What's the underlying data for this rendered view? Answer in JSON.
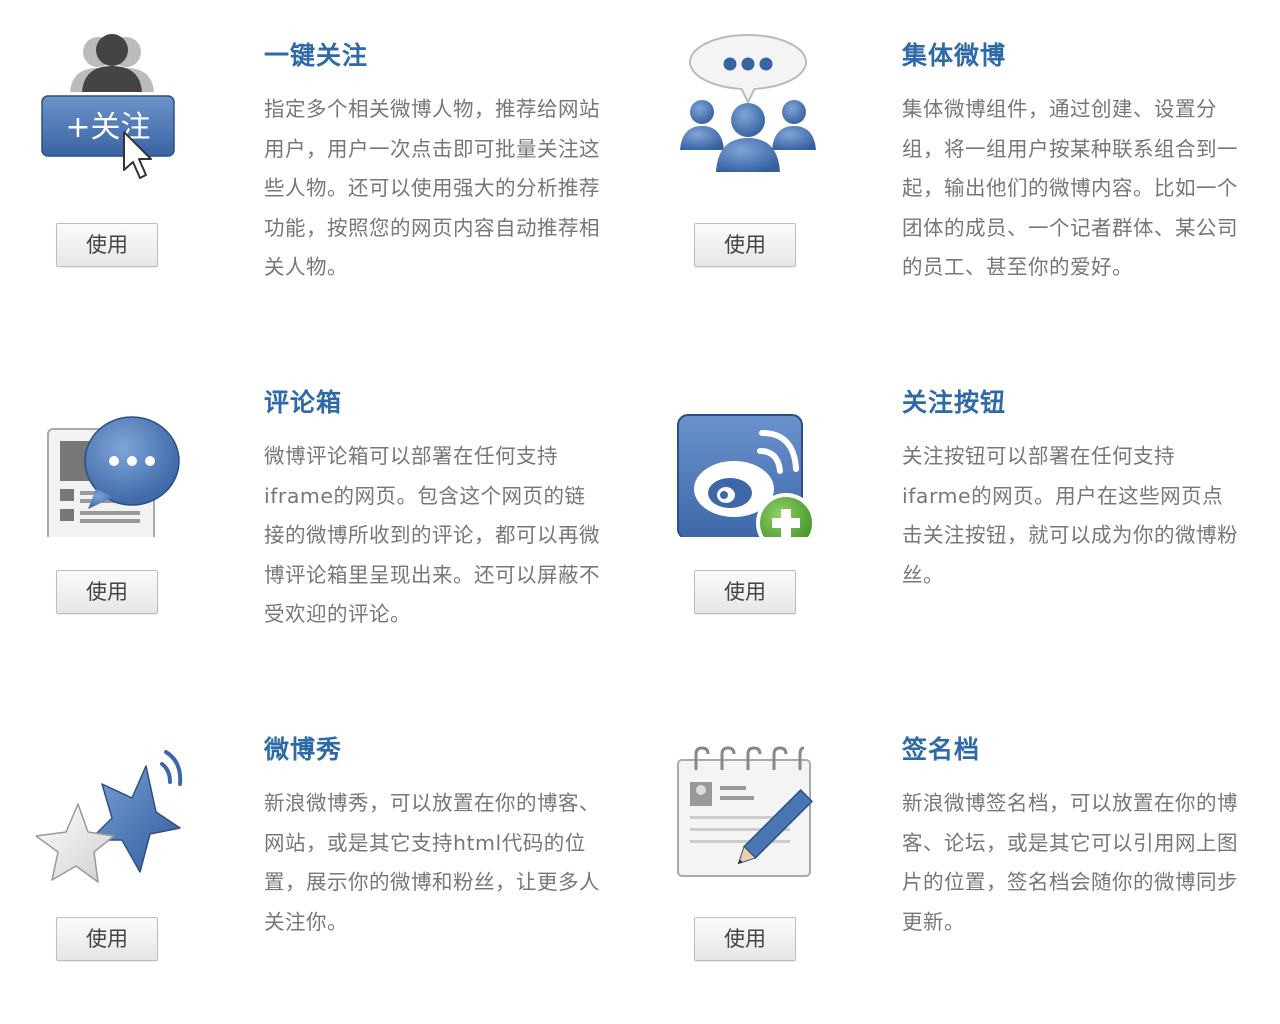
{
  "widgets": [
    {
      "title": "一键关注",
      "description": "指定多个相关微博人物，推荐给网站用户，用户一次点击即可批量关注这些人物。还可以使用强大的分析推荐功能，按照您的网页内容自动推荐相关人物。",
      "button": "使用",
      "icon": "batch-follow-icon",
      "icon_label": "+关注"
    },
    {
      "title": "集体微博",
      "description": "集体微博组件，通过创建、设置分组，将一组用户按某种联系组合到一起，输出他们的微博内容。比如一个团体的成员、一个记者群体、某公司的员工、甚至你的爱好。",
      "button": "使用",
      "icon": "group-chat-icon"
    },
    {
      "title": "评论箱",
      "description": "微博评论箱可以部署在任何支持iframe的网页。包含这个网页的链接的微博所收到的评论，都可以再微博评论箱里呈现出来。还可以屏蔽不受欢迎的评论。",
      "button": "使用",
      "icon": "comment-box-icon"
    },
    {
      "title": "关注按钮",
      "description": "关注按钮可以部署在任何支持ifarme的网页。用户在这些网页点击关注按钮，就可以成为你的微博粉丝。",
      "button": "使用",
      "icon": "weibo-follow-icon"
    },
    {
      "title": "微博秀",
      "description": "新浪微博秀，可以放置在你的博客、网站，或是其它支持html代码的位置，展示你的微博和粉丝，让更多人关注你。",
      "button": "使用",
      "icon": "weibo-show-stars-icon"
    },
    {
      "title": "签名档",
      "description": "新浪微博签名档，可以放置在你的博客、论坛，或是其它可以引用网上图片的位置，签名档会随你的微博同步更新。",
      "button": "使用",
      "icon": "signature-notepad-icon"
    }
  ],
  "colors": {
    "title": "#2e6aa7",
    "icon_blue": "#4a76b4",
    "text": "#777777"
  }
}
